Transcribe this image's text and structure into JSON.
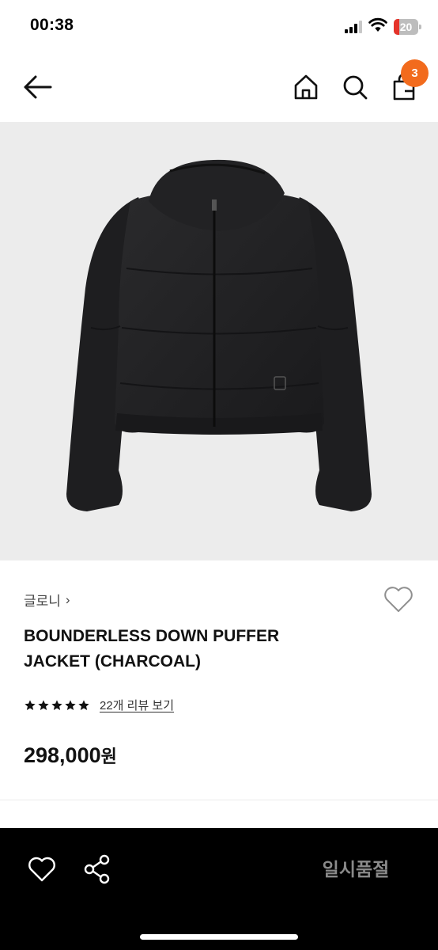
{
  "status_bar": {
    "time": "00:38",
    "battery_level": "20"
  },
  "nav": {
    "back_icon": "arrow-left-icon",
    "home_icon": "home-icon",
    "search_icon": "search-icon",
    "cart_icon": "shopping-bag-icon",
    "cart_count": "3"
  },
  "product": {
    "image": "charcoal-puffer-jacket-photo",
    "brand": "글로니",
    "brand_chevron": "›",
    "name_line1": "BOUNDERLESS DOWN PUFFER",
    "name_line2": "JACKET (CHARCOAL)",
    "rating_stars": 5,
    "review_link": "22개 리뷰 보기",
    "price": "298,000",
    "price_unit": "원"
  },
  "bottom_bar": {
    "wish_icon": "heart-icon",
    "share_icon": "share-icon",
    "status_button": "일시품절"
  },
  "colors": {
    "badge": "#f26b1d",
    "image_bg": "#ececec",
    "bottom_bar": "#000000",
    "soldout_text": "#8a8a8a"
  }
}
